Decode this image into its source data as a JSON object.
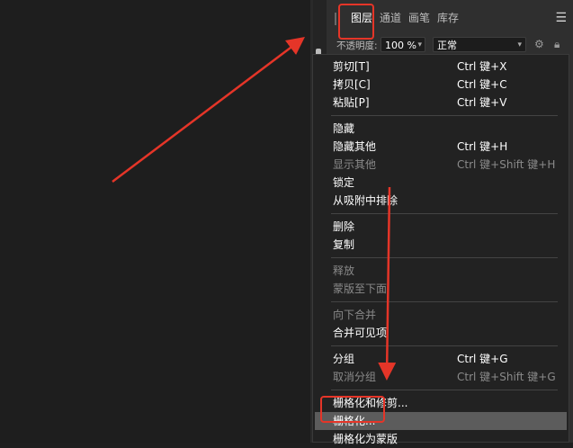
{
  "panel": {
    "tabs": [
      {
        "label": "图层",
        "active": true
      },
      {
        "label": "通道",
        "active": false
      },
      {
        "label": "画笔",
        "active": false
      },
      {
        "label": "库存",
        "active": false
      }
    ],
    "menu_icon": "hamburger-icon",
    "opacity_label": "不透明度:",
    "opacity_value": "100 %",
    "blend_mode": "正常",
    "gear_icon": "gear-icon",
    "lock_icon": "lock-icon"
  },
  "context_menu": {
    "groups": [
      [
        {
          "label": "剪切[T]",
          "shortcut": "Ctrl 键+X",
          "enabled": true
        },
        {
          "label": "拷贝[C]",
          "shortcut": "Ctrl 键+C",
          "enabled": true
        },
        {
          "label": "粘贴[P]",
          "shortcut": "Ctrl 键+V",
          "enabled": true
        }
      ],
      [
        {
          "label": "隐藏",
          "shortcut": "",
          "enabled": true
        },
        {
          "label": "隐藏其他",
          "shortcut": "Ctrl 键+H",
          "enabled": true
        },
        {
          "label": "显示其他",
          "shortcut": "Ctrl 键+Shift 键+H",
          "enabled": false
        },
        {
          "label": "锁定",
          "shortcut": "",
          "enabled": true
        },
        {
          "label": "从吸附中排除",
          "shortcut": "",
          "enabled": true
        }
      ],
      [
        {
          "label": "删除",
          "shortcut": "",
          "enabled": true
        },
        {
          "label": "复制",
          "shortcut": "",
          "enabled": true
        }
      ],
      [
        {
          "label": "释放",
          "shortcut": "",
          "enabled": false
        },
        {
          "label": "蒙版至下面",
          "shortcut": "",
          "enabled": false
        }
      ],
      [
        {
          "label": "向下合并",
          "shortcut": "",
          "enabled": false
        },
        {
          "label": "合并可见项",
          "shortcut": "",
          "enabled": true
        }
      ],
      [
        {
          "label": "分组",
          "shortcut": "Ctrl 键+G",
          "enabled": true
        },
        {
          "label": "取消分组",
          "shortcut": "Ctrl 键+Shift 键+G",
          "enabled": false
        }
      ],
      [
        {
          "label": "栅格化和修剪...",
          "shortcut": "",
          "enabled": true
        },
        {
          "label": "栅格化...",
          "shortcut": "",
          "enabled": true,
          "highlighted": true
        },
        {
          "label": "栅格化为蒙版",
          "shortcut": "",
          "enabled": true
        }
      ]
    ]
  },
  "colors": {
    "annotation": "#e53528",
    "highlight": "#5c5c5c",
    "disabled_text": "#8a8a8a"
  }
}
